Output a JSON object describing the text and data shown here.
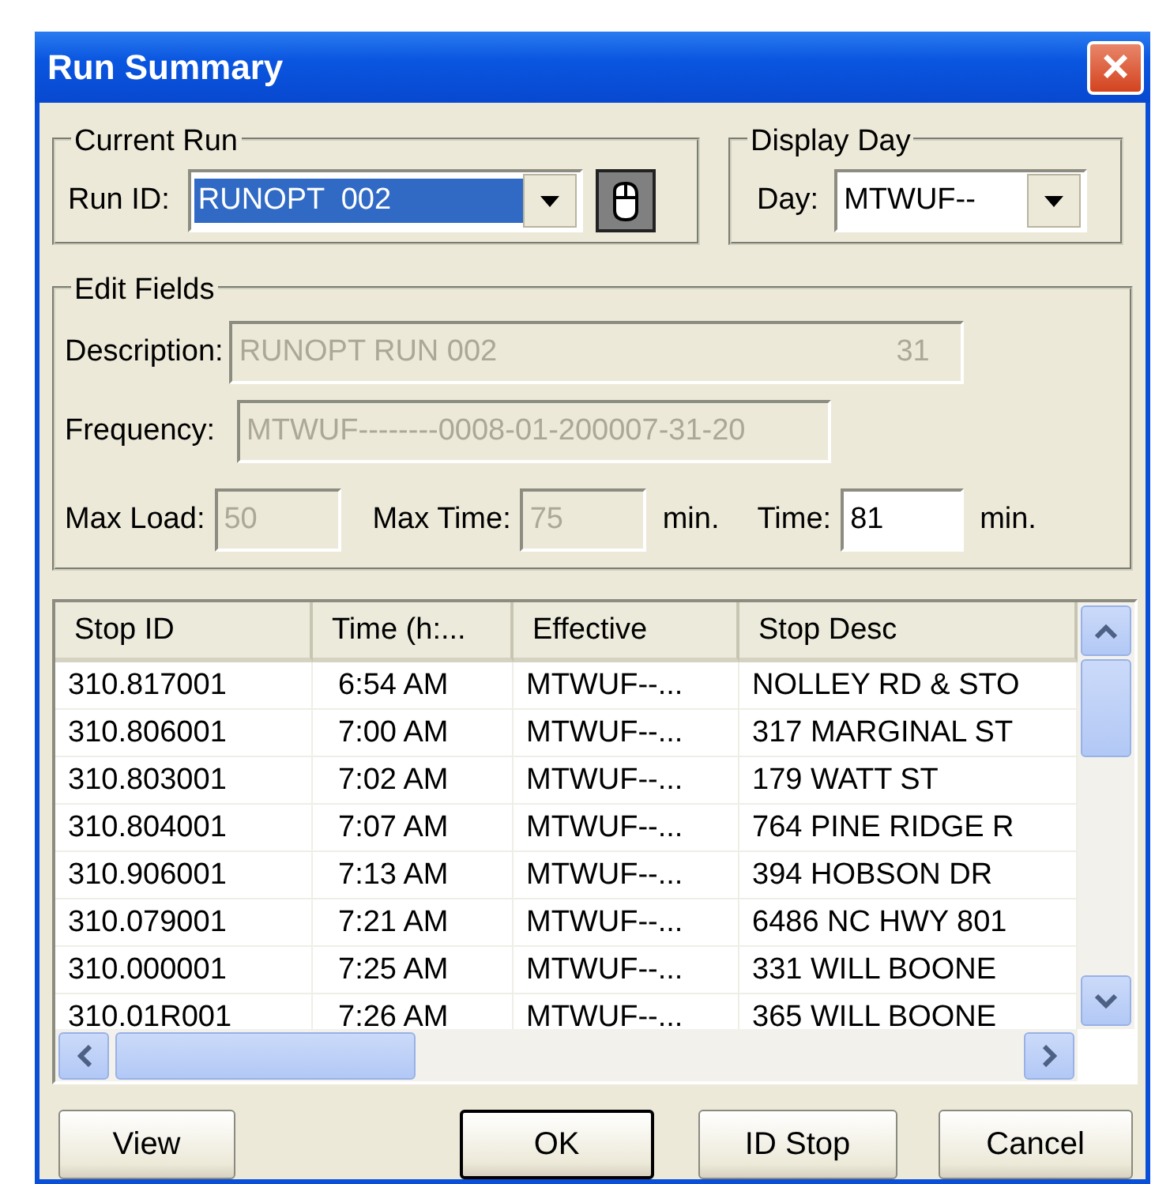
{
  "window": {
    "title": "Run Summary",
    "close": "×"
  },
  "current_run": {
    "title": "Current Run",
    "label": "Run ID:",
    "value": "RUNOPT  002",
    "text_selected": true
  },
  "display_day": {
    "title": "Display Day",
    "label": "Day:",
    "value": "MTWUF--"
  },
  "edit_fields": {
    "title": "Edit Fields",
    "description": {
      "label": "Description:",
      "value": "RUNOPT RUN 002",
      "code": "31",
      "disabled": true
    },
    "frequency": {
      "label": "Frequency:",
      "value": "MTWUF--------0008-01-200007-31-20",
      "disabled": true
    },
    "max_load": {
      "label": "Max Load:",
      "value": "50",
      "disabled": true
    },
    "max_time": {
      "label": "Max Time:",
      "value": "75",
      "unit": "min.",
      "disabled": true
    },
    "time": {
      "label": "Time:",
      "value": "81",
      "unit": "min.",
      "disabled": false
    }
  },
  "table": {
    "columns": [
      "Stop ID",
      "Time (h:...",
      "Effective",
      "Stop Desc"
    ],
    "rows": [
      [
        "310.817001",
        "6:54 AM",
        "MTWUF--...",
        "NOLLEY RD & STO"
      ],
      [
        "310.806001",
        "7:00 AM",
        "MTWUF--...",
        "317 MARGINAL ST"
      ],
      [
        "310.803001",
        "7:02 AM",
        "MTWUF--...",
        "179 WATT ST"
      ],
      [
        "310.804001",
        "7:07 AM",
        "MTWUF--...",
        "764 PINE RIDGE R"
      ],
      [
        "310.906001",
        "7:13 AM",
        "MTWUF--...",
        "394 HOBSON DR"
      ],
      [
        "310.079001",
        "7:21 AM",
        "MTWUF--...",
        "6486 NC HWY 801"
      ],
      [
        "310.000001",
        "7:25 AM",
        "MTWUF--...",
        "331 WILL BOONE"
      ],
      [
        "310.01R001",
        "7:26 AM",
        "MTWUF--...",
        "365 WILL BOONE"
      ]
    ]
  },
  "buttons": [
    {
      "label": "View",
      "default": false
    },
    {
      "label": "OK",
      "default": true
    },
    {
      "label": "ID Stop",
      "default": false
    },
    {
      "label": "Cancel",
      "default": false
    }
  ]
}
